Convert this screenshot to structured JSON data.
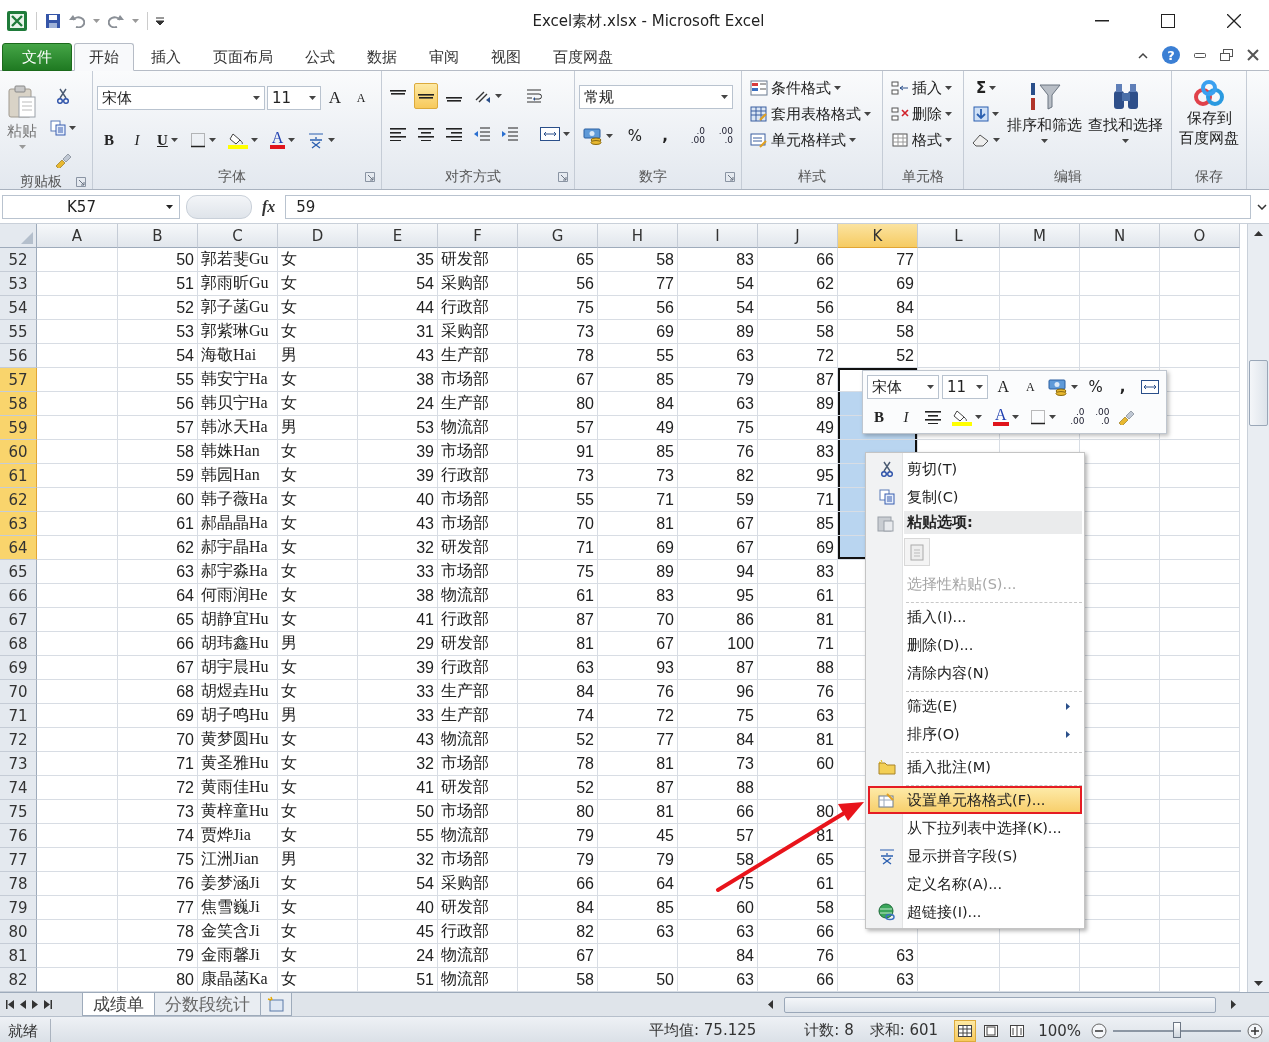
{
  "window": {
    "title": "Excel素材.xlsx  -  Microsoft Excel",
    "help": "?"
  },
  "ribbon_tabs": [
    {
      "label": "文件",
      "kind": "file",
      "selected": false
    },
    {
      "label": "开始",
      "kind": "tab",
      "selected": true
    },
    {
      "label": "插入",
      "kind": "tab",
      "selected": false
    },
    {
      "label": "页面布局",
      "kind": "tab",
      "selected": false
    },
    {
      "label": "公式",
      "kind": "tab",
      "selected": false
    },
    {
      "label": "数据",
      "kind": "tab",
      "selected": false
    },
    {
      "label": "审阅",
      "kind": "tab",
      "selected": false
    },
    {
      "label": "视图",
      "kind": "tab",
      "selected": false
    },
    {
      "label": "百度网盘",
      "kind": "tab",
      "selected": false
    }
  ],
  "ribbon": {
    "clipboard": {
      "paste": "粘贴",
      "label": "剪贴板"
    },
    "font": {
      "name": "宋体",
      "size": "11",
      "grow": "A",
      "shrink": "A",
      "bold": "B",
      "italic": "I",
      "underline": "U",
      "font_color_label": "A",
      "label": "字体"
    },
    "alignment": {
      "vertical": [
        {
          "selected": false
        },
        {
          "selected": true
        },
        {
          "selected": false
        }
      ],
      "label": "对齐方式"
    },
    "number": {
      "format": "常规",
      "percent": "%",
      "comma": ",",
      "increase_decimal": [
        ".0",
        ".00"
      ],
      "decrease_decimal": [
        ".00",
        ".0"
      ],
      "label": "数字"
    },
    "styles": {
      "items": [
        "条件格式",
        "套用表格格式",
        "单元格样式"
      ],
      "label": "样式"
    },
    "cells": {
      "items": [
        "插入",
        "删除",
        "格式"
      ],
      "label": "单元格"
    },
    "editing": {
      "sum": "Σ",
      "sort": "排序和筛选",
      "find": "查找和选择",
      "label": "编辑"
    },
    "save": {
      "lines": [
        "保存到",
        "百度网盘"
      ],
      "label": "保存"
    }
  },
  "formula_bar": {
    "name_box": "K57",
    "fx": "fx",
    "value": "59"
  },
  "columns": [
    {
      "label": "A",
      "selected": false
    },
    {
      "label": "B",
      "selected": false
    },
    {
      "label": "C",
      "selected": false
    },
    {
      "label": "D",
      "selected": false
    },
    {
      "label": "E",
      "selected": false
    },
    {
      "label": "F",
      "selected": false
    },
    {
      "label": "G",
      "selected": false
    },
    {
      "label": "H",
      "selected": false
    },
    {
      "label": "I",
      "selected": false
    },
    {
      "label": "J",
      "selected": false
    },
    {
      "label": "K",
      "selected": true
    },
    {
      "label": "L",
      "selected": false
    },
    {
      "label": "M",
      "selected": false
    },
    {
      "label": "N",
      "selected": false
    },
    {
      "label": "O",
      "selected": false
    }
  ],
  "rows": [
    {
      "row": "52",
      "b": "50",
      "c": "郭若斐Gu",
      "d": "女",
      "e": "35",
      "f": "研发部",
      "g": "65",
      "h": "58",
      "i": "83",
      "j": "66",
      "k": "77",
      "selected": false
    },
    {
      "row": "53",
      "b": "51",
      "c": "郭雨昕Gu",
      "d": "女",
      "e": "54",
      "f": "采购部",
      "g": "56",
      "h": "77",
      "i": "54",
      "j": "62",
      "k": "69",
      "selected": false
    },
    {
      "row": "54",
      "b": "52",
      "c": "郭子菡Gu",
      "d": "女",
      "e": "44",
      "f": "行政部",
      "g": "75",
      "h": "56",
      "i": "54",
      "j": "56",
      "k": "84",
      "selected": false
    },
    {
      "row": "55",
      "b": "53",
      "c": "郭紫琳Gu",
      "d": "女",
      "e": "31",
      "f": "采购部",
      "g": "73",
      "h": "69",
      "i": "89",
      "j": "58",
      "k": "58",
      "selected": false
    },
    {
      "row": "56",
      "b": "54",
      "c": "海敬Hai",
      "d": "男",
      "e": "43",
      "f": "生产部",
      "g": "78",
      "h": "55",
      "i": "63",
      "j": "72",
      "k": "52",
      "selected": false
    },
    {
      "row": "57",
      "b": "55",
      "c": "韩安宁Ha",
      "d": "女",
      "e": "38",
      "f": "市场部",
      "g": "67",
      "h": "85",
      "i": "79",
      "j": "87",
      "selected": true
    },
    {
      "row": "58",
      "b": "56",
      "c": "韩贝宁Ha",
      "d": "女",
      "e": "24",
      "f": "生产部",
      "g": "80",
      "h": "84",
      "i": "63",
      "j": "89",
      "selected": true
    },
    {
      "row": "59",
      "b": "57",
      "c": "韩冰天Ha",
      "d": "男",
      "e": "53",
      "f": "物流部",
      "g": "57",
      "h": "49",
      "i": "75",
      "j": "49",
      "selected": true
    },
    {
      "row": "60",
      "b": "58",
      "c": "韩姝Han",
      "d": "女",
      "e": "39",
      "f": "市场部",
      "g": "91",
      "h": "85",
      "i": "76",
      "j": "83",
      "selected": true
    },
    {
      "row": "61",
      "b": "59",
      "c": "韩园Han",
      "d": "女",
      "e": "39",
      "f": "行政部",
      "g": "73",
      "h": "73",
      "i": "82",
      "j": "95",
      "selected": true
    },
    {
      "row": "62",
      "b": "60",
      "c": "韩子薇Ha",
      "d": "女",
      "e": "40",
      "f": "市场部",
      "g": "55",
      "h": "71",
      "i": "59",
      "j": "71",
      "selected": true
    },
    {
      "row": "63",
      "b": "61",
      "c": "郝晶晶Ha",
      "d": "女",
      "e": "43",
      "f": "市场部",
      "g": "70",
      "h": "81",
      "i": "67",
      "j": "85",
      "selected": true
    },
    {
      "row": "64",
      "b": "62",
      "c": "郝宇晶Ha",
      "d": "女",
      "e": "32",
      "f": "研发部",
      "g": "71",
      "h": "69",
      "i": "67",
      "j": "69",
      "selected": true
    },
    {
      "row": "65",
      "b": "63",
      "c": "郝宇淼Ha",
      "d": "女",
      "e": "33",
      "f": "市场部",
      "g": "75",
      "h": "89",
      "i": "94",
      "j": "83",
      "selected": false
    },
    {
      "row": "66",
      "b": "64",
      "c": "何雨润He",
      "d": "女",
      "e": "38",
      "f": "物流部",
      "g": "61",
      "h": "83",
      "i": "95",
      "j": "61",
      "selected": false
    },
    {
      "row": "67",
      "b": "65",
      "c": "胡静宜Hu",
      "d": "女",
      "e": "41",
      "f": "行政部",
      "g": "87",
      "h": "70",
      "i": "86",
      "j": "81",
      "selected": false
    },
    {
      "row": "68",
      "b": "66",
      "c": "胡玮鑫Hu",
      "d": "男",
      "e": "29",
      "f": "研发部",
      "g": "81",
      "h": "67",
      "i": "100",
      "j": "71",
      "selected": false
    },
    {
      "row": "69",
      "b": "67",
      "c": "胡宇晨Hu",
      "d": "女",
      "e": "39",
      "f": "行政部",
      "g": "63",
      "h": "93",
      "i": "87",
      "j": "88",
      "selected": false
    },
    {
      "row": "70",
      "b": "68",
      "c": "胡煜垚Hu",
      "d": "女",
      "e": "33",
      "f": "生产部",
      "g": "84",
      "h": "76",
      "i": "96",
      "j": "76",
      "selected": false
    },
    {
      "row": "71",
      "b": "69",
      "c": "胡子鸣Hu",
      "d": "男",
      "e": "33",
      "f": "生产部",
      "g": "74",
      "h": "72",
      "i": "75",
      "j": "63",
      "selected": false
    },
    {
      "row": "72",
      "b": "70",
      "c": "黄梦圆Hu",
      "d": "女",
      "e": "43",
      "f": "物流部",
      "g": "52",
      "h": "77",
      "i": "84",
      "j": "81",
      "selected": false
    },
    {
      "row": "73",
      "b": "71",
      "c": "黄圣雅Hu",
      "d": "女",
      "e": "32",
      "f": "市场部",
      "g": "78",
      "h": "81",
      "i": "73",
      "j": "60",
      "selected": false
    },
    {
      "row": "74",
      "b": "72",
      "c": "黄雨佳Hu",
      "d": "女",
      "e": "41",
      "f": "研发部",
      "g": "52",
      "h": "87",
      "i": "88",
      "selected": false
    },
    {
      "row": "75",
      "b": "73",
      "c": "黄梓童Hu",
      "d": "女",
      "e": "50",
      "f": "市场部",
      "g": "80",
      "h": "81",
      "i": "66",
      "j": "80",
      "selected": false
    },
    {
      "row": "76",
      "b": "74",
      "c": "贾烨Jia",
      "d": "女",
      "e": "55",
      "f": "物流部",
      "g": "79",
      "h": "45",
      "i": "57",
      "j": "81",
      "selected": false
    },
    {
      "row": "77",
      "b": "75",
      "c": "江洲Jian",
      "d": "男",
      "e": "32",
      "f": "市场部",
      "g": "79",
      "h": "79",
      "i": "58",
      "j": "65",
      "selected": false
    },
    {
      "row": "78",
      "b": "76",
      "c": "姜梦涵Ji",
      "d": "女",
      "e": "54",
      "f": "采购部",
      "g": "66",
      "h": "64",
      "i": "75",
      "j": "61",
      "selected": false
    },
    {
      "row": "79",
      "b": "77",
      "c": "焦雪巍Ji",
      "d": "女",
      "e": "40",
      "f": "研发部",
      "g": "84",
      "h": "85",
      "i": "60",
      "j": "58",
      "selected": false
    },
    {
      "row": "80",
      "b": "78",
      "c": "金笑含Ji",
      "d": "女",
      "e": "45",
      "f": "行政部",
      "g": "82",
      "h": "63",
      "i": "63",
      "j": "66",
      "selected": false
    },
    {
      "row": "81",
      "b": "79",
      "c": "金雨馨Ji",
      "d": "女",
      "e": "24",
      "f": "物流部",
      "g": "67",
      "i": "84",
      "j": "76",
      "k": "63",
      "selected": false
    },
    {
      "row": "82",
      "b": "80",
      "c": "康晶菡Ka",
      "d": "女",
      "e": "51",
      "f": "物流部",
      "g": "58",
      "h": "50",
      "i": "63",
      "j": "66",
      "k": "63",
      "selected": false
    }
  ],
  "sheet_tabs": [
    {
      "label": "成绩单",
      "selected": true
    },
    {
      "label": "分数段统计",
      "selected": false
    }
  ],
  "status_bar": {
    "ready": "就绪",
    "average": "平均值: 75.125",
    "count": "计数: 8",
    "sum": "求和: 601",
    "views": [
      {
        "selected": true
      },
      {
        "selected": false
      },
      {
        "selected": false
      }
    ],
    "zoom": "100%",
    "level": 0.5
  },
  "mini_toolbar": {
    "font": "宋体",
    "size": "11",
    "grow": "A",
    "shrink": "A",
    "percent": "%",
    "comma": ",",
    "bold": "B",
    "italic": "I",
    "font_color_label": "A",
    "increase_decimal": [
      ".0",
      ".00"
    ],
    "decrease_decimal": [
      ".00",
      ".0"
    ]
  },
  "context_menu": {
    "items": [
      {
        "kind": "item",
        "label": "剪切(T)",
        "disabled": false,
        "submenu": false,
        "highlighted": false
      },
      {
        "kind": "item",
        "label": "复制(C)",
        "disabled": false,
        "submenu": false,
        "highlighted": false
      },
      {
        "kind": "header",
        "label": "粘贴选项:"
      },
      {
        "kind": "paste_option"
      },
      {
        "kind": "item",
        "label": "选择性粘贴(S)...",
        "disabled": true,
        "submenu": false,
        "highlighted": false
      },
      {
        "kind": "separator"
      },
      {
        "kind": "item",
        "label": "插入(I)...",
        "disabled": false,
        "submenu": false,
        "highlighted": false
      },
      {
        "kind": "item",
        "label": "删除(D)...",
        "disabled": false,
        "submenu": false,
        "highlighted": false
      },
      {
        "kind": "item",
        "label": "清除内容(N)",
        "disabled": false,
        "submenu": false,
        "highlighted": false
      },
      {
        "kind": "separator"
      },
      {
        "kind": "item",
        "label": "筛选(E)",
        "disabled": false,
        "submenu": true,
        "highlighted": false
      },
      {
        "kind": "item",
        "label": "排序(O)",
        "disabled": false,
        "submenu": true,
        "highlighted": false
      },
      {
        "kind": "separator"
      },
      {
        "kind": "item",
        "label": "插入批注(M)",
        "disabled": false,
        "submenu": false,
        "highlighted": false
      },
      {
        "kind": "separator"
      },
      {
        "kind": "item",
        "label": "设置单元格格式(F)...",
        "disabled": false,
        "submenu": false,
        "highlighted": true
      },
      {
        "kind": "item",
        "label": "从下拉列表中选择(K)...",
        "disabled": false,
        "submenu": false,
        "highlighted": false
      },
      {
        "kind": "item",
        "label": "显示拼音字段(S)",
        "disabled": false,
        "submenu": false,
        "highlighted": false
      },
      {
        "kind": "item",
        "label": "定义名称(A)...",
        "disabled": false,
        "submenu": false,
        "highlighted": false
      },
      {
        "kind": "item",
        "label": "超链接(I)...",
        "disabled": false,
        "submenu": false,
        "highlighted": false
      }
    ]
  }
}
